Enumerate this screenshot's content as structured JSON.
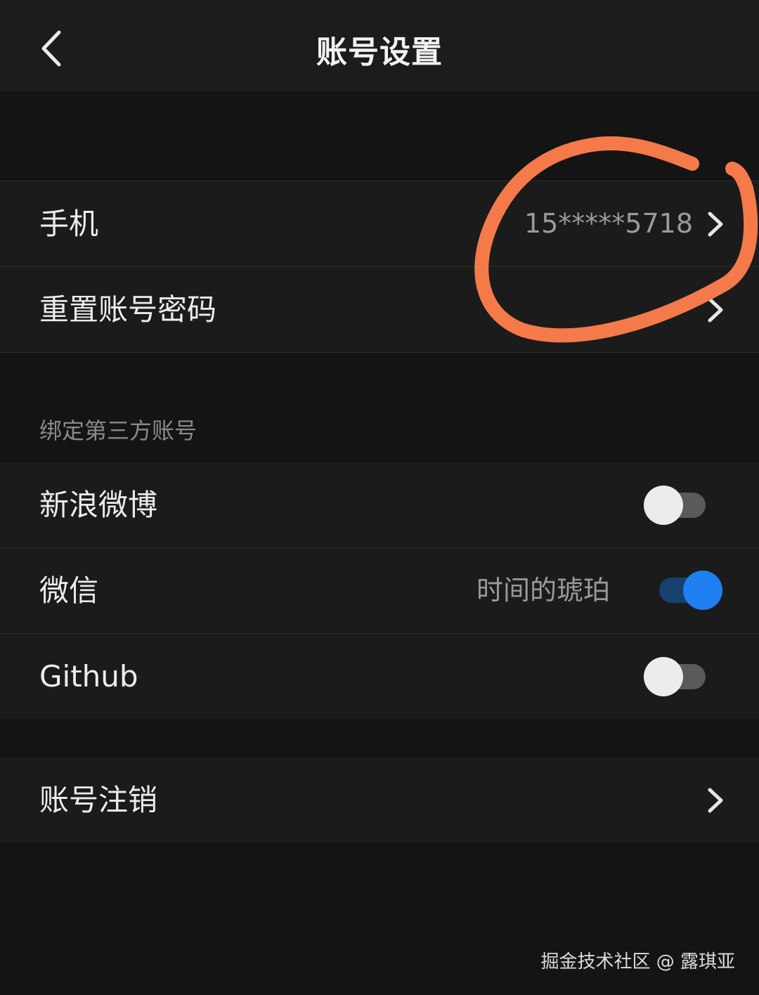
{
  "header": {
    "title": "账号设置",
    "back_icon": "chevron-left-icon"
  },
  "account_section": {
    "phone": {
      "label": "手机",
      "value": "15*****5718"
    },
    "reset_password": {
      "label": "重置账号密码"
    }
  },
  "third_party": {
    "header": "绑定第三方账号",
    "items": [
      {
        "label": "新浪微博",
        "value": "",
        "enabled": false
      },
      {
        "label": "微信",
        "value": "时间的琥珀",
        "enabled": true
      },
      {
        "label": "Github",
        "value": "",
        "enabled": false
      }
    ]
  },
  "cancel_account": {
    "label": "账号注销"
  },
  "watermark": "掘金技术社区 @ 露琪亚",
  "colors": {
    "background": "#141414",
    "row": "#1b1b1b",
    "toggle_on": "#1e80f0",
    "toggle_off_track": "#5a5a5a",
    "annotation_stroke": "#f47a4a"
  }
}
